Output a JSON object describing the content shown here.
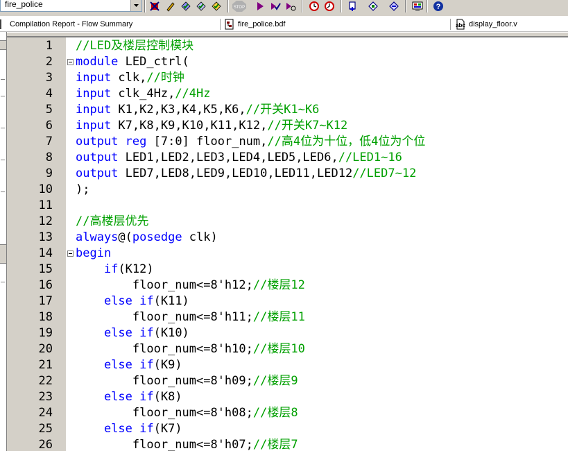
{
  "toolbar": {
    "project_name": "fire_police",
    "stop_label": "STOP"
  },
  "tabs": [
    {
      "label": "Compilation Report - Flow Summary",
      "icon": "report-icon"
    },
    {
      "label": "fire_police.bdf",
      "icon": "bdf-file-icon"
    },
    {
      "label": "display_floor.v",
      "icon": "verilog-file-icon"
    }
  ],
  "colors": {
    "keyword": "#0000ff",
    "plain": "#000000",
    "comment": "#00a000"
  },
  "editor": {
    "lines": [
      {
        "num": "1",
        "segs": [
          {
            "t": "//LED及楼层控制模块",
            "c": "c"
          }
        ]
      },
      {
        "num": "2",
        "segs": [
          {
            "t": "module",
            "c": "k"
          },
          {
            "t": " LED_ctrl(",
            "c": "p"
          }
        ]
      },
      {
        "num": "3",
        "segs": [
          {
            "t": "input",
            "c": "k"
          },
          {
            "t": " clk,",
            "c": "p"
          },
          {
            "t": "//时钟",
            "c": "c"
          }
        ]
      },
      {
        "num": "4",
        "segs": [
          {
            "t": "input",
            "c": "k"
          },
          {
            "t": " clk_4Hz,",
            "c": "p"
          },
          {
            "t": "//4Hz",
            "c": "c"
          }
        ]
      },
      {
        "num": "5",
        "segs": [
          {
            "t": "input",
            "c": "k"
          },
          {
            "t": " K1,K2,K3,K4,K5,K6,",
            "c": "p"
          },
          {
            "t": "//开关K1~K6",
            "c": "c"
          }
        ]
      },
      {
        "num": "6",
        "segs": [
          {
            "t": "input",
            "c": "k"
          },
          {
            "t": " K7,K8,K9,K10,K11,K12,",
            "c": "p"
          },
          {
            "t": "//开关K7~K12",
            "c": "c"
          }
        ]
      },
      {
        "num": "7",
        "segs": [
          {
            "t": "output",
            "c": "k"
          },
          {
            "t": " ",
            "c": "p"
          },
          {
            "t": "reg",
            "c": "k"
          },
          {
            "t": " [7:0] floor_num,",
            "c": "p"
          },
          {
            "t": "//高4位为十位，低4位为个位",
            "c": "c"
          }
        ]
      },
      {
        "num": "8",
        "segs": [
          {
            "t": "output",
            "c": "k"
          },
          {
            "t": " LED1,LED2,LED3,LED4,LED5,LED6,",
            "c": "p"
          },
          {
            "t": "//LED1~16",
            "c": "c"
          }
        ]
      },
      {
        "num": "9",
        "segs": [
          {
            "t": "output",
            "c": "k"
          },
          {
            "t": " LED7,LED8,LED9,LED10,LED11,LED12",
            "c": "p"
          },
          {
            "t": "//LED7~12",
            "c": "c"
          }
        ]
      },
      {
        "num": "10",
        "segs": [
          {
            "t": ");",
            "c": "p"
          }
        ]
      },
      {
        "num": "11",
        "segs": []
      },
      {
        "num": "12",
        "segs": [
          {
            "t": "//高楼层优先",
            "c": "c"
          }
        ]
      },
      {
        "num": "13",
        "segs": [
          {
            "t": "always",
            "c": "k"
          },
          {
            "t": "@(",
            "c": "p"
          },
          {
            "t": "posedge",
            "c": "k"
          },
          {
            "t": " clk)",
            "c": "p"
          }
        ]
      },
      {
        "num": "14",
        "segs": [
          {
            "t": "begin",
            "c": "k"
          }
        ]
      },
      {
        "num": "15",
        "segs": [
          {
            "t": "    ",
            "c": "p"
          },
          {
            "t": "if",
            "c": "k"
          },
          {
            "t": "(K12)",
            "c": "p"
          }
        ]
      },
      {
        "num": "16",
        "segs": [
          {
            "t": "        floor_num<=8'h12;",
            "c": "p"
          },
          {
            "t": "//楼层12",
            "c": "c"
          }
        ]
      },
      {
        "num": "17",
        "segs": [
          {
            "t": "    ",
            "c": "p"
          },
          {
            "t": "else if",
            "c": "k"
          },
          {
            "t": "(K11)",
            "c": "p"
          }
        ]
      },
      {
        "num": "18",
        "segs": [
          {
            "t": "        floor_num<=8'h11;",
            "c": "p"
          },
          {
            "t": "//楼层11",
            "c": "c"
          }
        ]
      },
      {
        "num": "19",
        "segs": [
          {
            "t": "    ",
            "c": "p"
          },
          {
            "t": "else if",
            "c": "k"
          },
          {
            "t": "(K10)",
            "c": "p"
          }
        ]
      },
      {
        "num": "20",
        "segs": [
          {
            "t": "        floor_num<=8'h10;",
            "c": "p"
          },
          {
            "t": "//楼层10",
            "c": "c"
          }
        ]
      },
      {
        "num": "21",
        "segs": [
          {
            "t": "    ",
            "c": "p"
          },
          {
            "t": "else if",
            "c": "k"
          },
          {
            "t": "(K9)",
            "c": "p"
          }
        ]
      },
      {
        "num": "22",
        "segs": [
          {
            "t": "        floor_num<=8'h09;",
            "c": "p"
          },
          {
            "t": "//楼层9",
            "c": "c"
          }
        ]
      },
      {
        "num": "23",
        "segs": [
          {
            "t": "    ",
            "c": "p"
          },
          {
            "t": "else if",
            "c": "k"
          },
          {
            "t": "(K8)",
            "c": "p"
          }
        ]
      },
      {
        "num": "24",
        "segs": [
          {
            "t": "        floor_num<=8'h08;",
            "c": "p"
          },
          {
            "t": "//楼层8",
            "c": "c"
          }
        ]
      },
      {
        "num": "25",
        "segs": [
          {
            "t": "    ",
            "c": "p"
          },
          {
            "t": "else if",
            "c": "k"
          },
          {
            "t": "(K7)",
            "c": "p"
          }
        ]
      },
      {
        "num": "26",
        "segs": [
          {
            "t": "        floor_num<=8'h07;",
            "c": "p"
          },
          {
            "t": "//楼层7",
            "c": "c"
          }
        ]
      }
    ]
  }
}
